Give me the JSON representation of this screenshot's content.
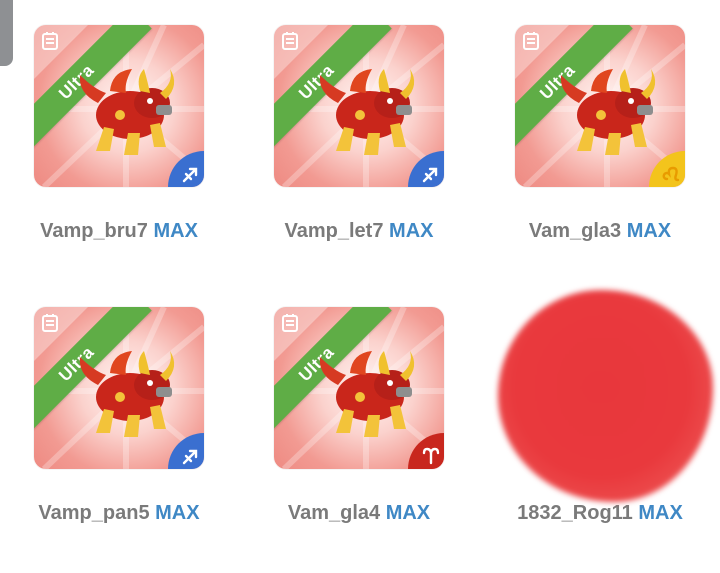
{
  "ribbon_color": "#5fad46",
  "max_color": "#3f88c5",
  "cards": [
    {
      "name": "Vamp_bru7",
      "level": "MAX",
      "rarity": "Ultra",
      "badge": "archer-sign-icon",
      "badge_color": "#3a6fd0"
    },
    {
      "name": "Vamp_let7",
      "level": "MAX",
      "rarity": "Ultra",
      "badge": "archer-sign-icon",
      "badge_color": "#3a6fd0"
    },
    {
      "name": "Vam_gla3",
      "level": "MAX",
      "rarity": "Ultra",
      "badge": "leo-sign-icon",
      "badge_color": "#f3c41c"
    },
    {
      "name": "Vamp_pan5",
      "level": "MAX",
      "rarity": "Ultra",
      "badge": "archer-sign-icon",
      "badge_color": "#3a6fd0"
    },
    {
      "name": "Vam_gla4",
      "level": "MAX",
      "rarity": "Ultra",
      "badge": "aries-sign-icon",
      "badge_color": "#c8271e"
    },
    {
      "name": "1832_Rog11",
      "level": "MAX",
      "rarity": "",
      "badge": "",
      "badge_color": ""
    }
  ]
}
